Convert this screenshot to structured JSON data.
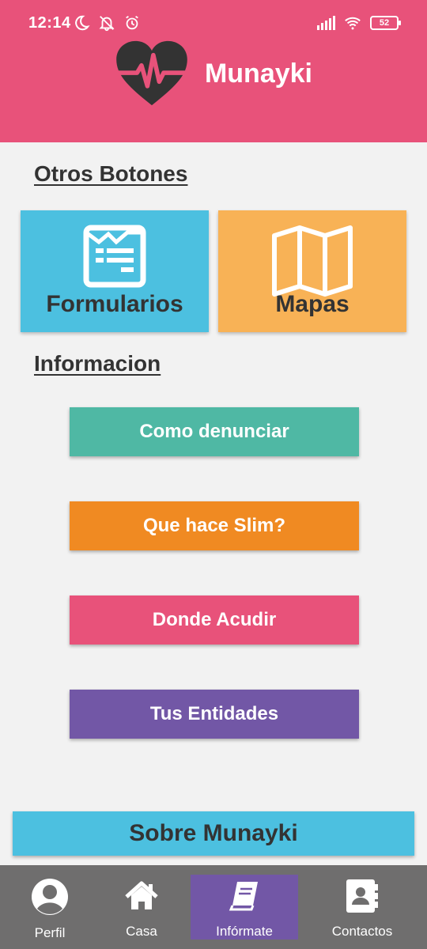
{
  "status_bar": {
    "time": "12:14",
    "battery": "52"
  },
  "header": {
    "app_name": "Munayki",
    "logo_icon": "heart-pulse-icon",
    "color": "#e8527a"
  },
  "sections": {
    "other_buttons_title": "Otros Botones",
    "info_title": "Informacion"
  },
  "tiles": [
    {
      "label": "Formularios",
      "icon": "form-icon",
      "color": "#4cc0e0"
    },
    {
      "label": "Mapas",
      "icon": "map-icon",
      "color": "#f8b256"
    }
  ],
  "info_buttons": [
    {
      "label": "Como denunciar",
      "color": "#4fb8a4"
    },
    {
      "label": "Que hace Slim?",
      "color": "#f08a22"
    },
    {
      "label": "Donde Acudir",
      "color": "#e8527a"
    },
    {
      "label": "Tus Entidades",
      "color": "#7257a6"
    }
  ],
  "about_button": {
    "label": "Sobre Munayki",
    "color": "#4cc0e0"
  },
  "bottom_nav": {
    "items": [
      {
        "label": "Perfil",
        "icon": "user-circle-icon"
      },
      {
        "label": "Casa",
        "icon": "home-icon"
      },
      {
        "label": "Infórmate",
        "icon": "book-icon",
        "active": true
      },
      {
        "label": "Contactos",
        "icon": "contacts-icon"
      }
    ],
    "active_color": "#7257a6",
    "background": "#6f6e6e"
  }
}
